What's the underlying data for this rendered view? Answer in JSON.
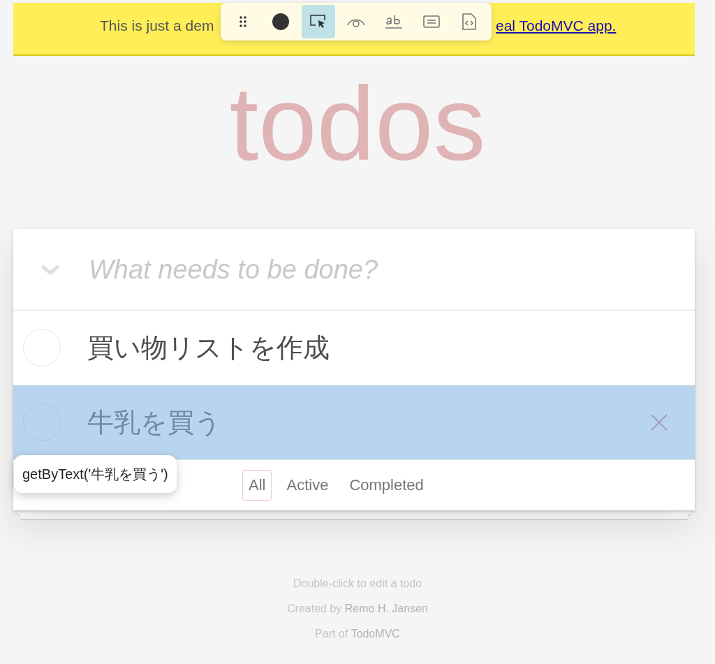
{
  "banner": {
    "text": "This is just a dem",
    "link": "eal TodoMVC app."
  },
  "toolbar": {
    "tools": [
      {
        "kind": "drag",
        "selected": false
      },
      {
        "kind": "record",
        "selected": false
      },
      {
        "kind": "pick",
        "selected": true
      },
      {
        "kind": "eye",
        "selected": false
      },
      {
        "kind": "text",
        "selected": false
      },
      {
        "kind": "value",
        "selected": false
      },
      {
        "kind": "code",
        "selected": false
      }
    ]
  },
  "title": "todos",
  "new_todo": {
    "placeholder": "What needs to be done?"
  },
  "todos": [
    {
      "title": "買い物リストを作成",
      "highlighted": false
    },
    {
      "title": "牛乳を買う",
      "highlighted": true
    }
  ],
  "filters": [
    {
      "label": "All",
      "selected": true
    },
    {
      "label": "Active",
      "selected": false
    },
    {
      "label": "Completed",
      "selected": false
    }
  ],
  "tooltip": "getByText('牛乳を買う')",
  "info": {
    "hint": "Double-click to edit a todo",
    "created_prefix": "Created by ",
    "author": "Remo H. Jansen",
    "part_prefix": "Part of ",
    "part_link": "TodoMVC"
  }
}
